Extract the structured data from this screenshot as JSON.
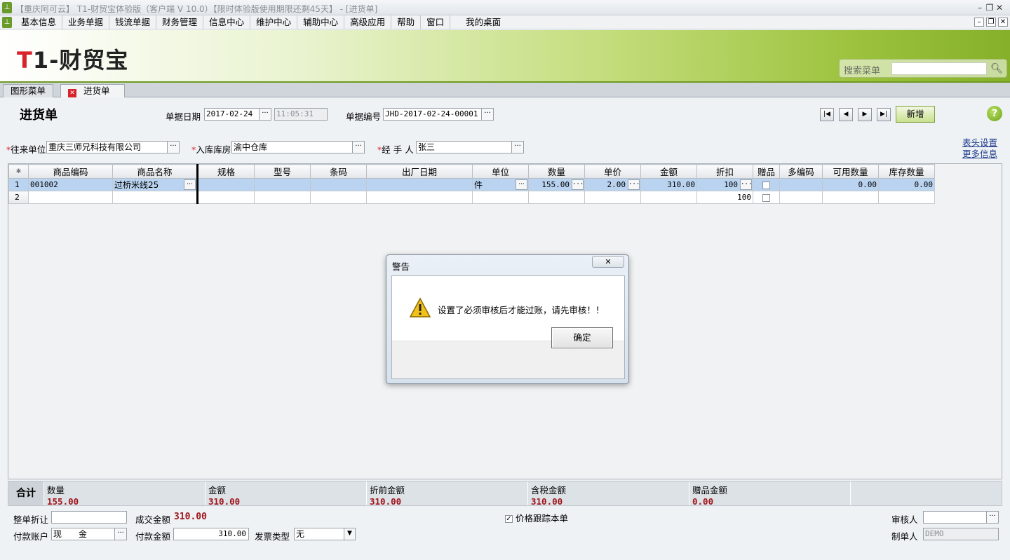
{
  "window": {
    "title": "【重庆阿可云】 T1-财贸宝体验版（客户端 V 10.0）【限时体验版使用期限还剩45天】 - [进货单]",
    "controls": [
      "minimize",
      "restore",
      "close"
    ]
  },
  "menubar": {
    "items": [
      "基本信息",
      "业务单据",
      "钱流单据",
      "财务管理",
      "信息中心",
      "维护中心",
      "辅助中心",
      "高级应用",
      "帮助",
      "窗口",
      "我的桌面"
    ]
  },
  "banner": {
    "logo_t": "T",
    "logo_rest": "1-财贸宝",
    "search_label": "搜索菜单",
    "search_value": ""
  },
  "tabs": [
    {
      "label": "图形菜单",
      "active": false
    },
    {
      "label": "进货单",
      "active": true
    }
  ],
  "form": {
    "title": "进货单",
    "date_label": "单据日期",
    "date_value": "2017-02-24",
    "time_value": "11:05:31",
    "docno_label": "单据编号",
    "docno_value": "JHD-2017-02-24-00001",
    "new_button": "新增",
    "help": "?",
    "partner_req": "*",
    "partner_label": "往来单位",
    "partner_value": "重庆三师兄科技有限公司",
    "warehouse_req": "*",
    "warehouse_label": "入库库房",
    "warehouse_value": "渝中仓库",
    "handler_req": "*",
    "handler_label": "经 手 人",
    "handler_value": "张三",
    "link_header_settings": "表头设置",
    "link_more_info": "更多信息"
  },
  "grid": {
    "corner": "✱",
    "columns": [
      "商品编码",
      "商品名称",
      "规格",
      "型号",
      "条码",
      "出厂日期",
      "单位",
      "数量",
      "单价",
      "金额",
      "折扣",
      "赠品",
      "多编码",
      "可用数量",
      "库存数量"
    ],
    "rows": [
      {
        "idx": "1",
        "code": "001002",
        "name": "过桥米线25",
        "spec": "",
        "model": "",
        "barcode": "",
        "mfg_date": "",
        "unit": "件",
        "qty": "155.00",
        "price": "2.00",
        "amount": "310.00",
        "discount": "100",
        "multi_code": "",
        "available": "0.00",
        "stock": "0.00"
      },
      {
        "idx": "2",
        "code": "",
        "name": "",
        "spec": "",
        "model": "",
        "barcode": "",
        "mfg_date": "",
        "unit": "",
        "qty": "",
        "price": "",
        "amount": "",
        "discount": "100",
        "multi_code": "",
        "available": "",
        "stock": ""
      }
    ]
  },
  "summary": {
    "label": "合计",
    "cells": [
      {
        "label": "数量",
        "value": "155.00"
      },
      {
        "label": "金额",
        "value": "310.00"
      },
      {
        "label": "折前金额",
        "value": "310.00"
      },
      {
        "label": "含税金额",
        "value": "310.00"
      },
      {
        "label": "赠品金额",
        "value": "0.00"
      }
    ]
  },
  "footer": {
    "discount_label": "整单折让",
    "discount_value": "",
    "deal_amount_label": "成交金额",
    "deal_amount_value": "310.00",
    "price_track_label": "价格跟踪本单",
    "price_track_checked": "✓",
    "auditor_label": "审核人",
    "auditor_value": "",
    "pay_account_label": "付款账户",
    "pay_account_value": "现　　金",
    "pay_amount_label": "付款金额",
    "pay_amount_value": "310.00",
    "invoice_label": "发票类型",
    "invoice_value": "无",
    "maker_label": "制单人",
    "maker_value": "DEMO"
  },
  "dialog": {
    "title": "警告",
    "message": "设置了必须审核后才能过账，请先审核！！",
    "ok_button": "确定",
    "close_glyph": "✕"
  }
}
